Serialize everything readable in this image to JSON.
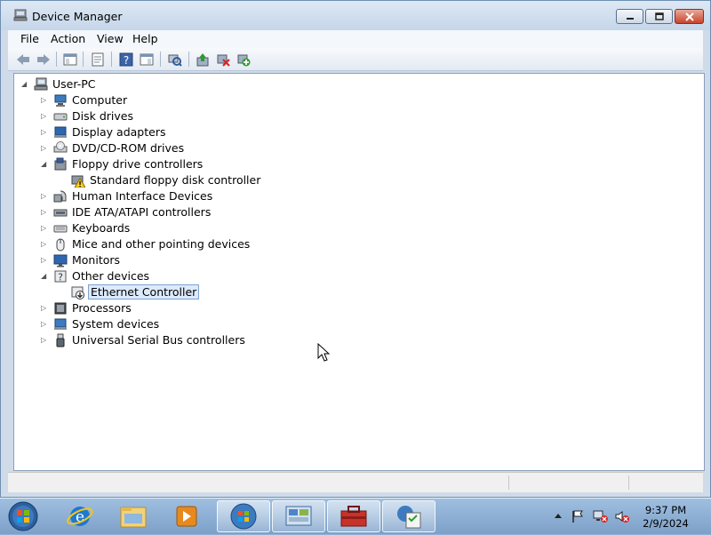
{
  "window": {
    "title": "Device Manager",
    "controls": {
      "minimize": "minimize",
      "maximize": "maximize",
      "close": "close"
    }
  },
  "menu": [
    "File",
    "Action",
    "View",
    "Help"
  ],
  "toolbar": [
    "back-arrow-icon",
    "forward-arrow-icon",
    "show-hide-console-tree-icon",
    "properties-icon",
    "help-icon",
    "action-pane-icon",
    "scan-hardware-icon",
    "update-driver-icon",
    "uninstall-icon",
    "enable-device-icon"
  ],
  "tree": {
    "root": "User-PC",
    "categories": [
      {
        "label": "Computer",
        "expanded": false,
        "icon": "computer-icon"
      },
      {
        "label": "Disk drives",
        "expanded": false,
        "icon": "disk-drive-icon"
      },
      {
        "label": "Display adapters",
        "expanded": false,
        "icon": "display-adapter-icon"
      },
      {
        "label": "DVD/CD-ROM drives",
        "expanded": false,
        "icon": "dvd-drive-icon"
      },
      {
        "label": "Floppy drive controllers",
        "expanded": true,
        "icon": "floppy-controller-icon",
        "children": [
          {
            "label": "Standard floppy disk controller",
            "icon": "warning-device-icon"
          }
        ]
      },
      {
        "label": "Human Interface Devices",
        "expanded": false,
        "icon": "hid-icon"
      },
      {
        "label": "IDE ATA/ATAPI controllers",
        "expanded": false,
        "icon": "ide-controller-icon"
      },
      {
        "label": "Keyboards",
        "expanded": false,
        "icon": "keyboard-icon"
      },
      {
        "label": "Mice and other pointing devices",
        "expanded": false,
        "icon": "mouse-icon"
      },
      {
        "label": "Monitors",
        "expanded": false,
        "icon": "monitor-icon"
      },
      {
        "label": "Other devices",
        "expanded": true,
        "icon": "unknown-device-icon",
        "children": [
          {
            "label": "Ethernet Controller",
            "icon": "disabled-device-icon",
            "selected": true
          }
        ]
      },
      {
        "label": "Processors",
        "expanded": false,
        "icon": "processor-icon"
      },
      {
        "label": "System devices",
        "expanded": false,
        "icon": "system-device-icon"
      },
      {
        "label": "Universal Serial Bus controllers",
        "expanded": false,
        "icon": "usb-icon"
      }
    ]
  },
  "taskbar": {
    "apps": [
      "start-orb-icon",
      "internet-explorer-icon",
      "windows-explorer-icon",
      "media-player-icon",
      "windows-orb-icon",
      "control-panel-icon",
      "toolbox-icon",
      "task-checklist-icon"
    ],
    "time": "9:37 PM",
    "date": "2/9/2024"
  },
  "colors": {
    "selection": "#dceafc",
    "selection_border": "#7da2ce",
    "window_frame": "#cfdbe9"
  }
}
